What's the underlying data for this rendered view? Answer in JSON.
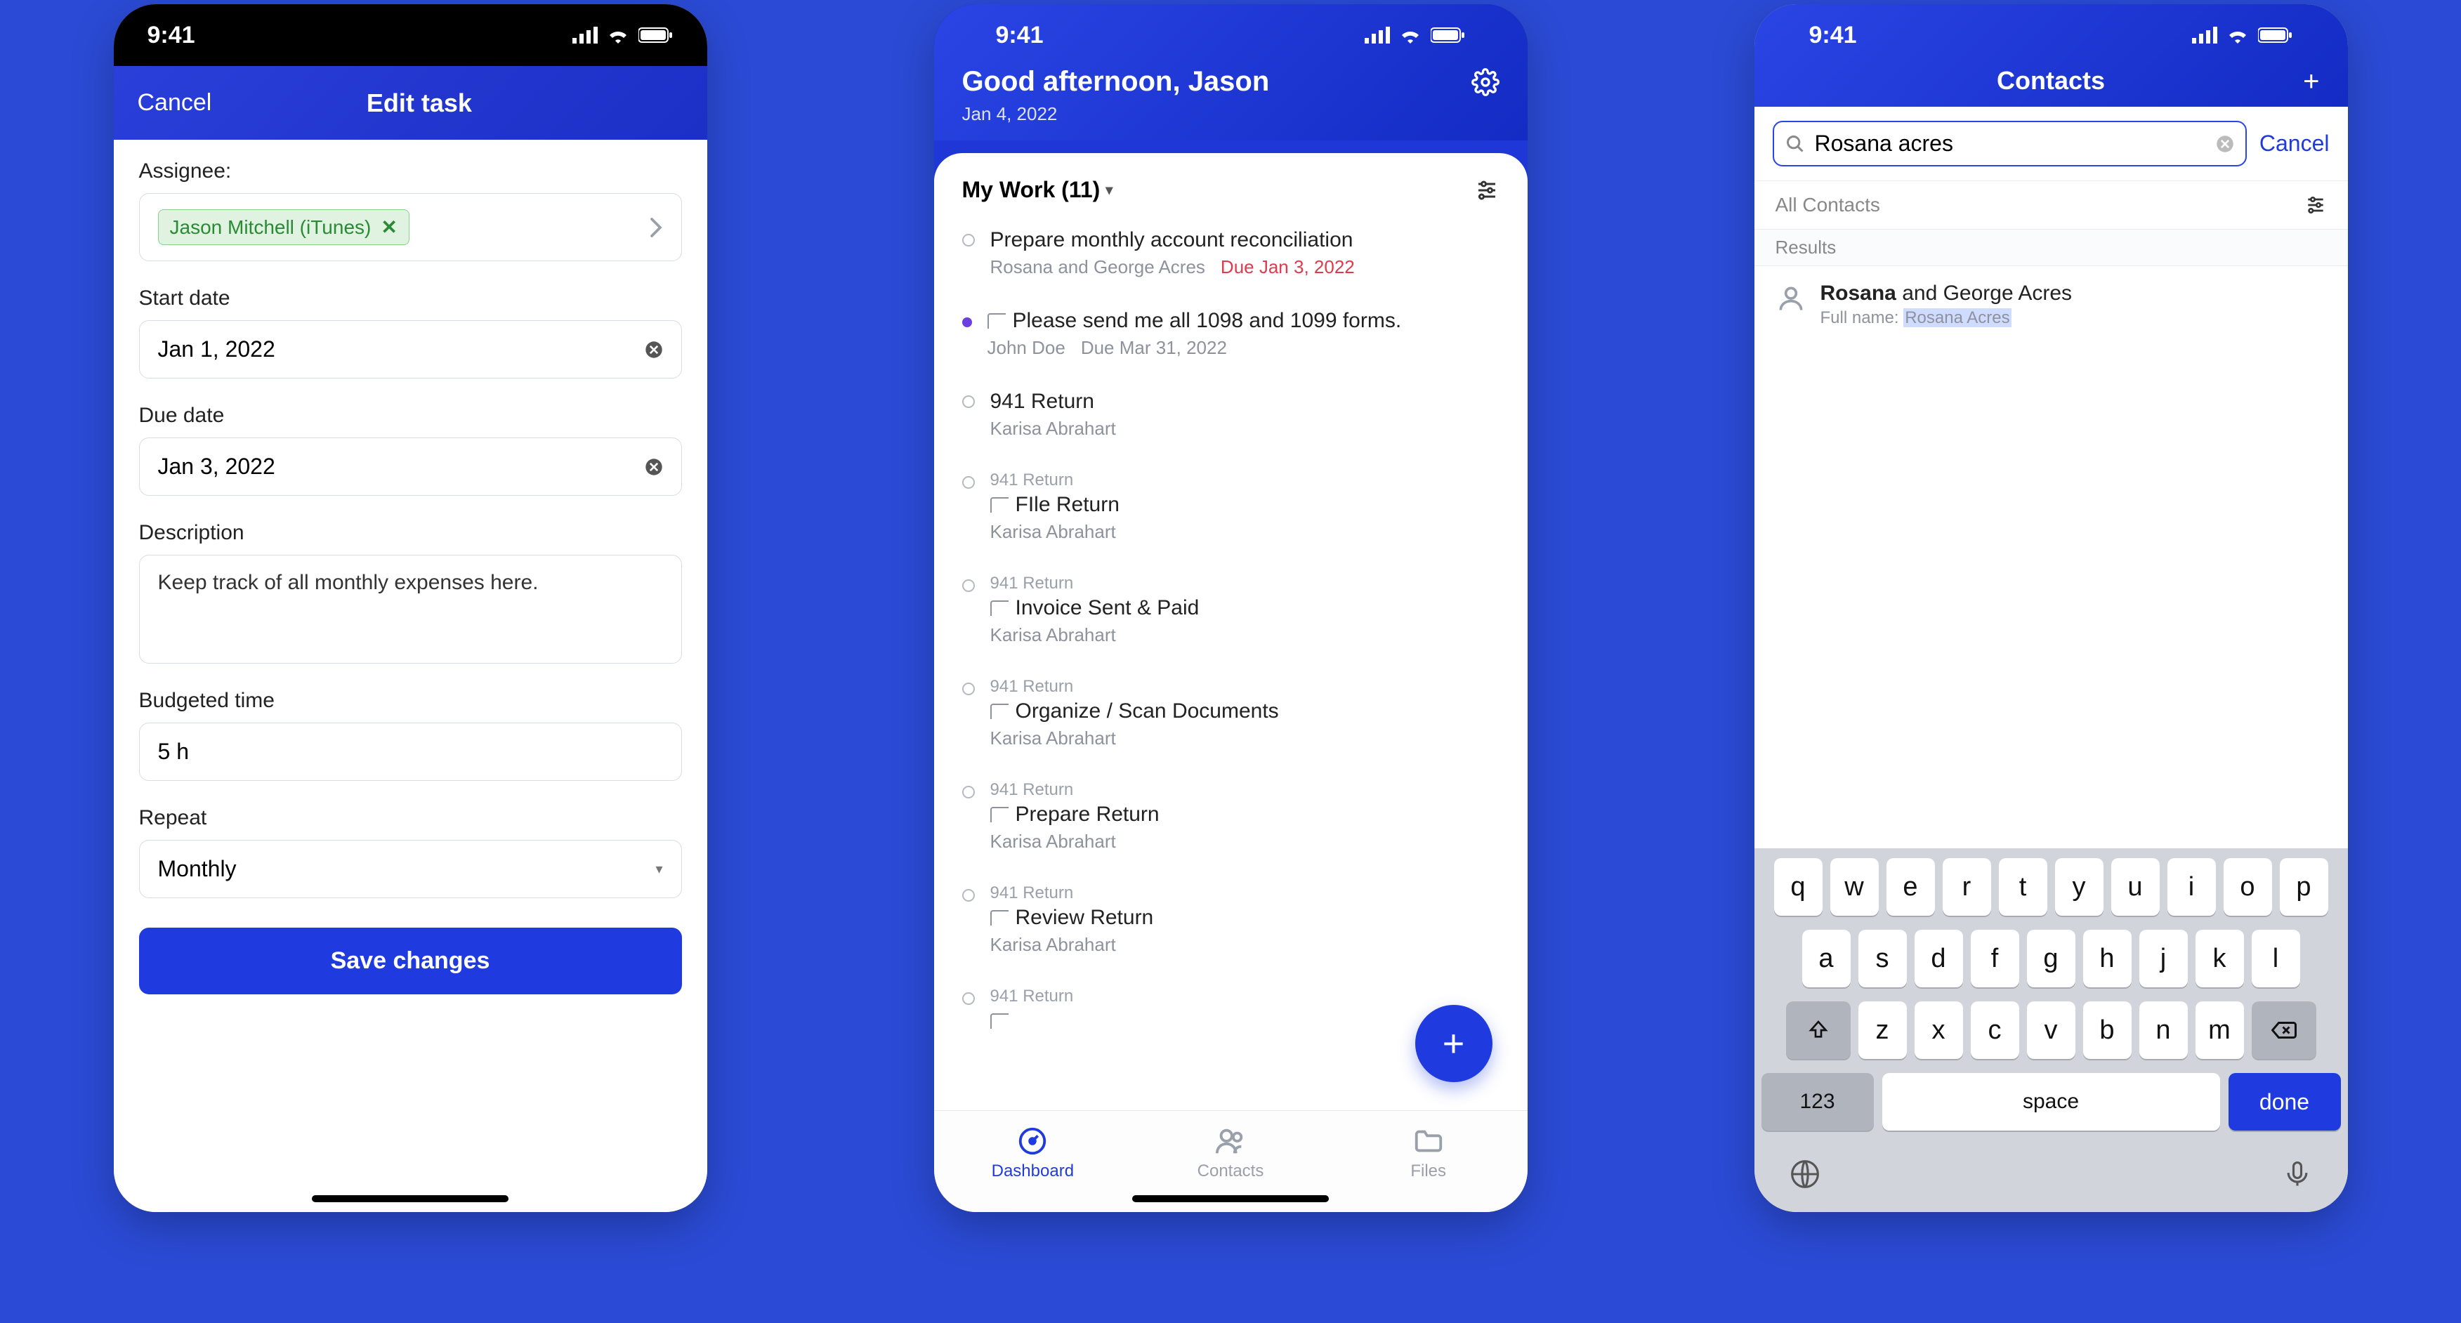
{
  "status": {
    "time": "9:41"
  },
  "phone1": {
    "nav": {
      "cancel": "Cancel",
      "title": "Edit task"
    },
    "labels": {
      "assignee": "Assignee:",
      "start_date": "Start date",
      "due_date": "Due date",
      "description": "Description",
      "budgeted_time": "Budgeted time",
      "repeat": "Repeat"
    },
    "values": {
      "assignee_chip": "Jason Mitchell (iTunes)",
      "start_date": "Jan 1, 2022",
      "due_date": "Jan 3, 2022",
      "description": "Keep track of all monthly expenses here.",
      "budgeted_time": "5 h",
      "repeat": "Monthly"
    },
    "save_button": "Save changes"
  },
  "phone2": {
    "greeting": "Good afternoon, Jason",
    "date": "Jan 4, 2022",
    "list_title": "My Work (11)",
    "tasks": [
      {
        "title": "Prepare monthly account reconciliation",
        "assignee": "Rosana and George Acres",
        "due": "Due Jan 3, 2022",
        "due_color": "red",
        "parent": "",
        "subtask": false
      },
      {
        "title": "Please send me all 1098 and 1099 forms.",
        "assignee": "John Doe",
        "due": "Due Mar 31, 2022",
        "due_color": "",
        "parent": "",
        "subtask": true,
        "bullet": "purple"
      },
      {
        "title": "941 Return",
        "assignee": "Karisa Abrahart",
        "due": "",
        "parent": "",
        "subtask": false
      },
      {
        "title": "FIle Return",
        "assignee": "Karisa Abrahart",
        "due": "",
        "parent": "941 Return",
        "subtask": true
      },
      {
        "title": "Invoice Sent & Paid",
        "assignee": "Karisa Abrahart",
        "due": "",
        "parent": "941 Return",
        "subtask": true
      },
      {
        "title": "Organize / Scan Documents",
        "assignee": "Karisa Abrahart",
        "due": "",
        "parent": "941 Return",
        "subtask": true
      },
      {
        "title": "Prepare Return",
        "assignee": "Karisa Abrahart",
        "due": "",
        "parent": "941 Return",
        "subtask": true
      },
      {
        "title": "Review Return",
        "assignee": "Karisa Abrahart",
        "due": "",
        "parent": "941 Return",
        "subtask": true
      },
      {
        "title": "",
        "assignee": "",
        "due": "",
        "parent": "941 Return",
        "subtask": true
      }
    ],
    "tabs": {
      "dashboard": "Dashboard",
      "contacts": "Contacts",
      "files": "Files"
    }
  },
  "phone3": {
    "title": "Contacts",
    "search_value": "Rosana acres",
    "cancel": "Cancel",
    "section": "All Contacts",
    "results_label": "Results",
    "result": {
      "name_bold": "Rosana",
      "name_rest": " and George Acres",
      "sub_label": "Full name: ",
      "sub_highlight": "Rosana Acres"
    },
    "keyboard": {
      "row1": [
        "q",
        "w",
        "e",
        "r",
        "t",
        "y",
        "u",
        "i",
        "o",
        "p"
      ],
      "row2": [
        "a",
        "s",
        "d",
        "f",
        "g",
        "h",
        "j",
        "k",
        "l"
      ],
      "row3": [
        "z",
        "x",
        "c",
        "v",
        "b",
        "n",
        "m"
      ],
      "num": "123",
      "space": "space",
      "done": "done"
    }
  }
}
